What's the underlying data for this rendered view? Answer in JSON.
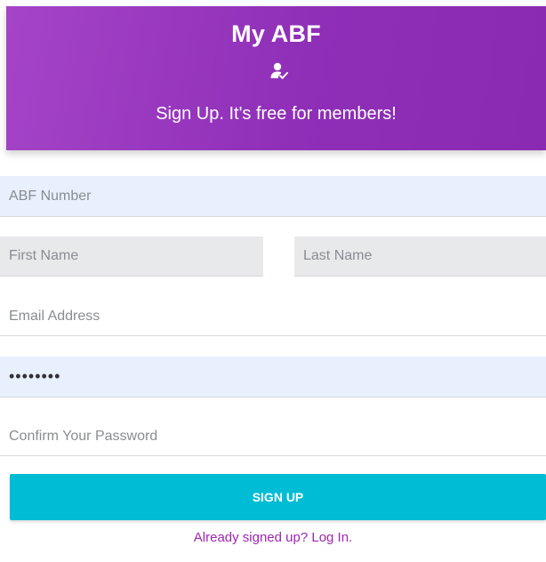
{
  "header": {
    "title": "My ABF",
    "icon": "user-check-icon",
    "tagline": "Sign Up. It's free for members!"
  },
  "form": {
    "abf_number_placeholder": "ABF Number",
    "first_name_placeholder": "First Name",
    "last_name_placeholder": "Last Name",
    "email_placeholder": "Email Address",
    "password_value": "........",
    "confirm_password_placeholder": "Confirm Your Password",
    "signup_label": "SIGN UP",
    "login_link": "Already signed up? Log In."
  },
  "colors": {
    "header_gradient_start": "#a544c7",
    "header_gradient_end": "#8a2ab2",
    "button": "#00bcd4",
    "link": "#9c27b0",
    "field_autofill_blue": "#e8f0fd",
    "field_gray": "#e7e9eb"
  }
}
